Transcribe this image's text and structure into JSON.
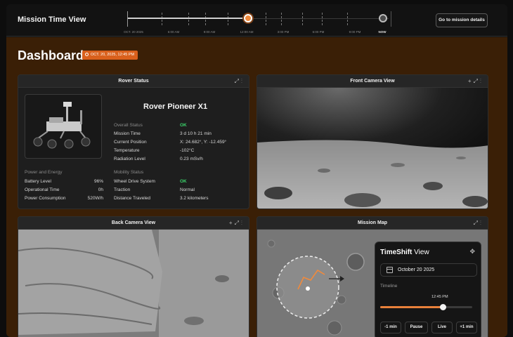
{
  "header": {
    "title": "Mission Time View",
    "details_button": "Go to mission details",
    "timeline": {
      "labels": [
        "OCT. 20 2025",
        "6:00 AM",
        "9:00 AM",
        "12:00 AM",
        "3:00 PM",
        "6:00 PM",
        "9:00 PM",
        "NOW"
      ],
      "progress": 0.455
    }
  },
  "dashboard": {
    "title": "Dashboard",
    "date_badge": "OCT. 20, 2025, 12:45 PM"
  },
  "rover_status": {
    "title": "Rover Status",
    "name": "Rover Pioneer X1",
    "rows": [
      {
        "label": "Overall Status",
        "value": "OK"
      },
      {
        "label": "Mission Time",
        "value": "3 d 10 h 21 min"
      },
      {
        "label": "Current Position",
        "value": "X: 24.682°, Y: -12.459°"
      },
      {
        "label": "Temperature",
        "value": "-102°C"
      },
      {
        "label": "Radiation Level",
        "value": "0.23 mSv/h"
      }
    ],
    "power_title": "Power and Energy",
    "power_rows": [
      {
        "label": "Battery Level",
        "value": "96%"
      },
      {
        "label": "Operational Time",
        "value": "0h"
      },
      {
        "label": "Power Consumption",
        "value": "520W/h"
      }
    ],
    "mobility_title": "Mobility Status",
    "mobility_rows": [
      {
        "label": "Wheel Drive System",
        "value": "OK"
      },
      {
        "label": "Traction",
        "value": "Normal"
      },
      {
        "label": "Distance Traveled",
        "value": "3.2 kilometers"
      }
    ]
  },
  "front_camera": {
    "title": "Front Camera View"
  },
  "back_camera": {
    "title": "Back Camera View"
  },
  "mission_map": {
    "title": "Mission Map"
  },
  "timeshift": {
    "title_bold": "TimeShift",
    "title_rest": " View",
    "date": "October 20 2025",
    "timeline_label": "Timeline",
    "time": "12:45 PM",
    "progress": 0.68,
    "buttons": [
      "-1 min",
      "Pause",
      "Live",
      "+1 min"
    ]
  },
  "colors": {
    "accent": "#f08a3c",
    "ok": "#3bd26a",
    "dashboard_bg": "#3a1f06"
  }
}
